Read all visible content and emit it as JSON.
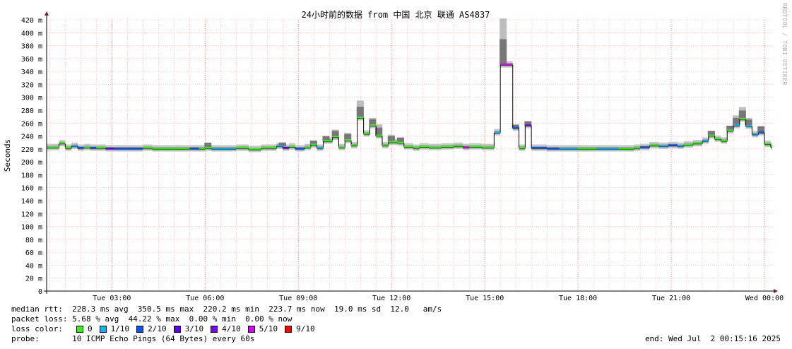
{
  "watermark": "RRDTOOL / TOBI OETIKER",
  "chart_data": {
    "type": "line",
    "title": "24小时前的数据 from 中国 北京 联通 AS4837",
    "ylabel": "Seconds",
    "ylim": [
      0,
      420
    ],
    "y_ticks": [
      {
        "v": 0,
        "label": "0"
      },
      {
        "v": 20,
        "label": "20 m"
      },
      {
        "v": 40,
        "label": "40 m"
      },
      {
        "v": 60,
        "label": "60 m"
      },
      {
        "v": 80,
        "label": "80 m"
      },
      {
        "v": 100,
        "label": "100 m"
      },
      {
        "v": 120,
        "label": "120 m"
      },
      {
        "v": 140,
        "label": "140 m"
      },
      {
        "v": 160,
        "label": "160 m"
      },
      {
        "v": 180,
        "label": "180 m"
      },
      {
        "v": 200,
        "label": "200 m"
      },
      {
        "v": 220,
        "label": "220 m"
      },
      {
        "v": 240,
        "label": "240 m"
      },
      {
        "v": 260,
        "label": "260 m"
      },
      {
        "v": 280,
        "label": "280 m"
      },
      {
        "v": 300,
        "label": "300 m"
      },
      {
        "v": 320,
        "label": "320 m"
      },
      {
        "v": 340,
        "label": "340 m"
      },
      {
        "v": 360,
        "label": "360 m"
      },
      {
        "v": 380,
        "label": "380 m"
      },
      {
        "v": 400,
        "label": "400 m"
      },
      {
        "v": 420,
        "label": "420 m"
      }
    ],
    "x_ticks": [
      {
        "h": 3,
        "label": "Tue 03:00"
      },
      {
        "h": 6,
        "label": "Tue 06:00"
      },
      {
        "h": 9,
        "label": "Tue 09:00"
      },
      {
        "h": 12,
        "label": "Tue 12:00"
      },
      {
        "h": 15,
        "label": "Tue 15:00"
      },
      {
        "h": 18,
        "label": "Tue 18:00"
      },
      {
        "h": 21,
        "label": "Tue 21:00"
      },
      {
        "h": 24,
        "label": "Wed 00:00"
      }
    ],
    "xlim_hours": [
      0.9,
      24.25
    ],
    "grid": true,
    "loss_colors": {
      "0": "#26ff00",
      "1/10": "#00b8ff",
      "2/10": "#0059ff",
      "3/10": "#5e00ff",
      "4/10": "#7e00ff",
      "5/10": "#dd00ff",
      "9/10": "#ff0000"
    },
    "median_series": [
      [
        0.9,
        222,
        "0"
      ],
      [
        1.3,
        228,
        "0"
      ],
      [
        1.5,
        221,
        "0"
      ],
      [
        1.7,
        224,
        "1/10"
      ],
      [
        1.9,
        221,
        "2/10"
      ],
      [
        2.1,
        222,
        "0"
      ],
      [
        2.3,
        221,
        "2/10"
      ],
      [
        2.5,
        221,
        "0"
      ],
      [
        2.8,
        220,
        "3/10"
      ],
      [
        3.1,
        220,
        "2/10"
      ],
      [
        3.5,
        220,
        "2/10"
      ],
      [
        4.0,
        221,
        "0"
      ],
      [
        4.3,
        220,
        "0"
      ],
      [
        5.0,
        220,
        "0"
      ],
      [
        5.5,
        220,
        "2/10"
      ],
      [
        5.8,
        220,
        "0"
      ],
      [
        6.0,
        221,
        "0"
      ],
      [
        6.2,
        220,
        "1/10"
      ],
      [
        7.0,
        221,
        "0"
      ],
      [
        7.4,
        219,
        "0"
      ],
      [
        7.8,
        221,
        "0"
      ],
      [
        8.1,
        221,
        "0"
      ],
      [
        8.3,
        224,
        "1/10"
      ],
      [
        8.5,
        221,
        "3/10"
      ],
      [
        8.7,
        223,
        "0"
      ],
      [
        8.9,
        220,
        "2/10"
      ],
      [
        9.2,
        222,
        "0"
      ],
      [
        9.4,
        226,
        "0"
      ],
      [
        9.6,
        221,
        "1/10"
      ],
      [
        9.8,
        232,
        "0"
      ],
      [
        10.1,
        238,
        "0"
      ],
      [
        10.3,
        222,
        "0"
      ],
      [
        10.5,
        233,
        "0"
      ],
      [
        10.7,
        225,
        "0"
      ],
      [
        10.9,
        268,
        "0"
      ],
      [
        11.1,
        243,
        "0"
      ],
      [
        11.3,
        256,
        "0"
      ],
      [
        11.5,
        240,
        "0"
      ],
      [
        11.7,
        225,
        "0"
      ],
      [
        11.9,
        230,
        "0"
      ],
      [
        12.2,
        229,
        "0"
      ],
      [
        12.4,
        223,
        "0"
      ],
      [
        12.7,
        221,
        "0"
      ],
      [
        12.9,
        223,
        "0"
      ],
      [
        13.2,
        222,
        "0"
      ],
      [
        13.6,
        223,
        "0"
      ],
      [
        14.0,
        224,
        "0"
      ],
      [
        14.3,
        222,
        "5/10"
      ],
      [
        14.5,
        223,
        "0"
      ],
      [
        14.7,
        223,
        "0"
      ],
      [
        14.9,
        222,
        "0"
      ],
      [
        15.3,
        245,
        "1/10"
      ],
      [
        15.5,
        350,
        "5/10"
      ],
      [
        15.9,
        252,
        "2/10"
      ],
      [
        16.1,
        221,
        "0"
      ],
      [
        16.3,
        256,
        "4/10"
      ],
      [
        16.5,
        221,
        "2/10"
      ],
      [
        17.0,
        220,
        "2/10"
      ],
      [
        17.4,
        220,
        "1/10"
      ],
      [
        18.0,
        220,
        "0"
      ],
      [
        18.6,
        220,
        "1/10"
      ],
      [
        19.3,
        220,
        "0"
      ],
      [
        19.8,
        221,
        "0"
      ],
      [
        20.0,
        222,
        "2/10"
      ],
      [
        20.3,
        225,
        "0"
      ],
      [
        20.6,
        224,
        "1/10"
      ],
      [
        20.9,
        225,
        "2/10"
      ],
      [
        21.2,
        224,
        "1/10"
      ],
      [
        21.4,
        226,
        "0"
      ],
      [
        21.7,
        228,
        "0"
      ],
      [
        22.0,
        232,
        "1/10"
      ],
      [
        22.2,
        240,
        "0"
      ],
      [
        22.4,
        235,
        "0"
      ],
      [
        22.6,
        232,
        "0"
      ],
      [
        22.8,
        248,
        "0"
      ],
      [
        23.0,
        256,
        "1/10"
      ],
      [
        23.2,
        266,
        "0"
      ],
      [
        23.4,
        255,
        "1/10"
      ],
      [
        23.6,
        242,
        "1/10"
      ],
      [
        23.8,
        245,
        "2/10"
      ],
      [
        24.0,
        227,
        "0"
      ],
      [
        24.2,
        223,
        "0"
      ]
    ],
    "smoke_spikes": [
      [
        6.0,
        230
      ],
      [
        8.4,
        228
      ],
      [
        9.4,
        232
      ],
      [
        9.8,
        240
      ],
      [
        10.1,
        250
      ],
      [
        10.5,
        245
      ],
      [
        10.9,
        295
      ],
      [
        11.3,
        268
      ],
      [
        11.5,
        258
      ],
      [
        11.9,
        242
      ],
      [
        12.2,
        238
      ],
      [
        15.5,
        422
      ],
      [
        15.9,
        255
      ],
      [
        16.3,
        262
      ],
      [
        22.2,
        248
      ],
      [
        22.8,
        256
      ],
      [
        23.0,
        272
      ],
      [
        23.2,
        285
      ],
      [
        23.4,
        268
      ],
      [
        23.8,
        256
      ]
    ]
  },
  "stats": {
    "median_rtt": "median rtt:  228.3 ms avg  350.5 ms max  220.2 ms min  223.7 ms now  19.0 ms sd  12.0   am/s",
    "packet_loss": "packet loss: 5.68 % avg  44.22 % max  0.00 % min  0.00 % now",
    "loss_color_label": "loss color:",
    "loss_legend": [
      {
        "label": "0",
        "color": "#26ff00"
      },
      {
        "label": "1/10",
        "color": "#00b8ff"
      },
      {
        "label": "2/10",
        "color": "#0059ff"
      },
      {
        "label": "3/10",
        "color": "#5e00ff"
      },
      {
        "label": "4/10",
        "color": "#7e00ff"
      },
      {
        "label": "5/10",
        "color": "#dd00ff"
      },
      {
        "label": "9/10",
        "color": "#ff0000"
      }
    ],
    "probe": "probe:       10 ICMP Echo Pings (64 Bytes) every 60s",
    "end": "end: Wed Jul  2 00:15:16 2025"
  }
}
